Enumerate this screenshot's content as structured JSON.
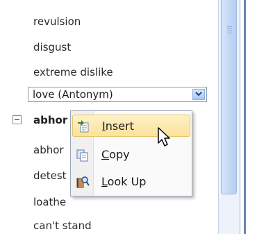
{
  "synonyms_top": [
    "revulsion",
    "disgust",
    "extreme dislike"
  ],
  "selected_entry": "love (Antonym)",
  "header_entry": "abhor",
  "synonyms_bottom": [
    "abhor",
    "detest",
    "loathe",
    "can't stand"
  ],
  "context_menu": {
    "items": [
      {
        "first": "I",
        "rest": "nsert",
        "icon": "insert-icon"
      },
      {
        "first": "C",
        "rest": "opy",
        "icon": "copy-icon"
      },
      {
        "first": "L",
        "rest": "ook Up",
        "icon": "look-up-icon"
      }
    ]
  },
  "colors": {
    "menu_hover": "#fce29a",
    "scrollbar": "#c4d8f5"
  }
}
